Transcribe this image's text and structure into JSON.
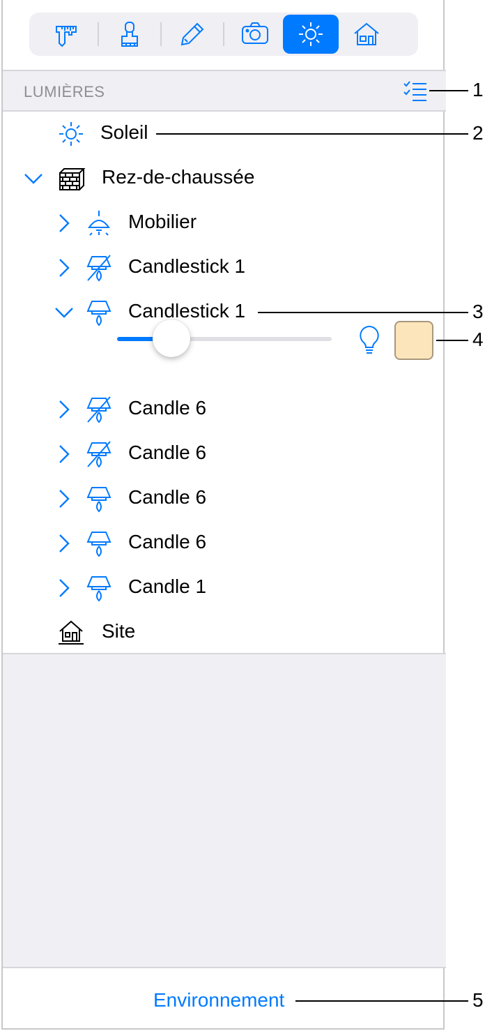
{
  "toolbar": {
    "tabs": [
      {
        "icon": "caliper-icon",
        "active": false
      },
      {
        "icon": "brush-icon",
        "active": false
      },
      {
        "icon": "pencil-icon",
        "active": false
      },
      {
        "icon": "camera-icon",
        "active": false
      },
      {
        "icon": "sun-icon",
        "active": true
      },
      {
        "icon": "house-icon",
        "active": false
      }
    ]
  },
  "section": {
    "title": "LUMIÈRES",
    "list_icon": "checklist-icon"
  },
  "tree": {
    "sun": {
      "label": "Soleil",
      "icon": "sun-icon"
    },
    "level": {
      "label": "Rez-de-chaussée",
      "icon": "brick-box-icon",
      "expanded": true
    },
    "items": [
      {
        "label": "Mobilier",
        "icon": "ceiling-lamp-icon",
        "enabled": true,
        "expanded": false
      },
      {
        "label": "Candlestick 1",
        "icon": "lamp-off-icon",
        "enabled": false,
        "expanded": false
      },
      {
        "label": "Candlestick 1",
        "icon": "lamp-icon",
        "enabled": true,
        "expanded": true
      },
      {
        "label": "Candle 6",
        "icon": "lamp-off-icon",
        "enabled": false,
        "expanded": false
      },
      {
        "label": "Candle 6",
        "icon": "lamp-off-icon",
        "enabled": false,
        "expanded": false
      },
      {
        "label": "Candle 6",
        "icon": "lamp-icon",
        "enabled": true,
        "expanded": false
      },
      {
        "label": "Candle 6",
        "icon": "lamp-icon",
        "enabled": true,
        "expanded": false
      },
      {
        "label": "Candle 1",
        "icon": "lamp-icon",
        "enabled": true,
        "expanded": false
      }
    ],
    "site": {
      "label": "Site",
      "icon": "site-house-icon"
    }
  },
  "light_settings": {
    "intensity": 0.2,
    "bulb_icon": "bulb-icon",
    "color": "#fde5bb"
  },
  "footer": {
    "link": "Environnement"
  },
  "callouts": [
    "1",
    "2",
    "3",
    "4",
    "5"
  ],
  "colors": {
    "accent": "#007aff",
    "header_bg": "#efeff4",
    "secondary_text": "#8e8e93"
  }
}
